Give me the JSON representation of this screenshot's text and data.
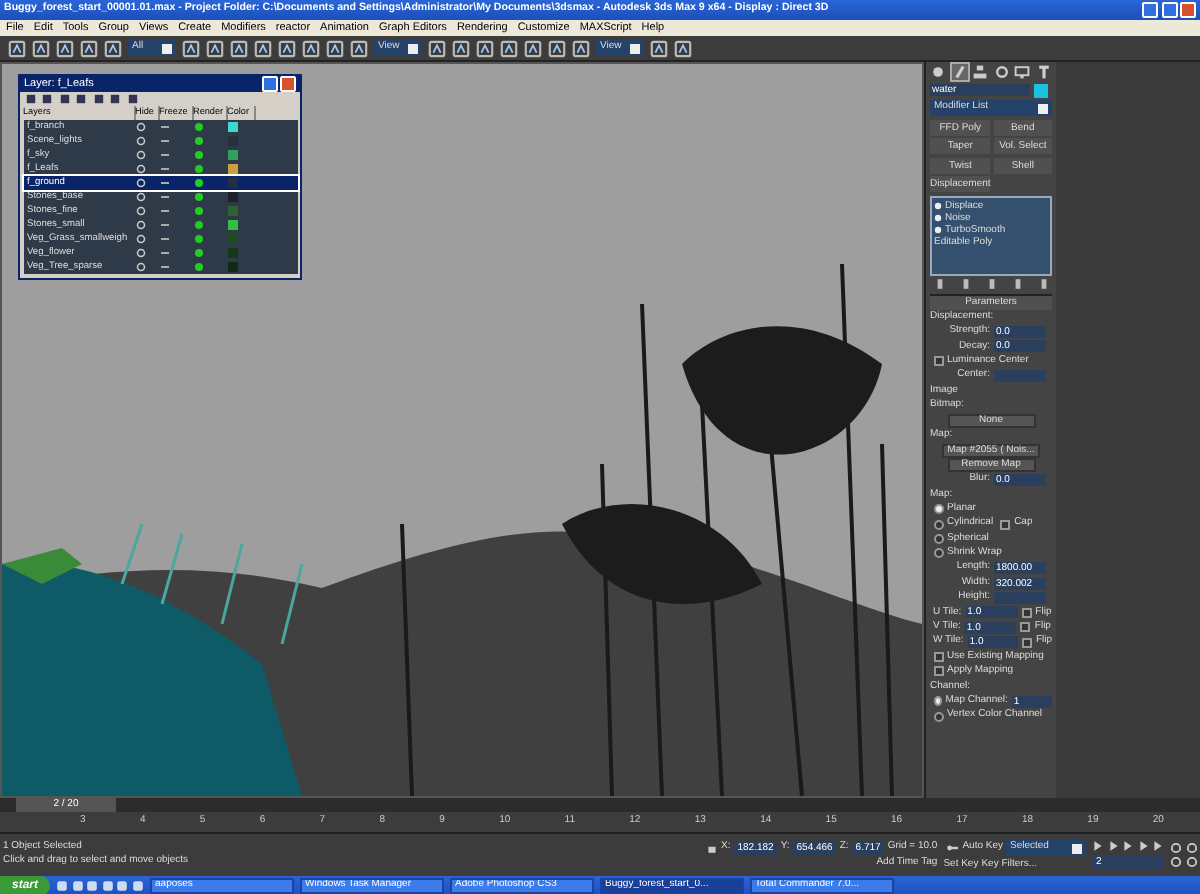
{
  "window": {
    "title": "Buggy_forest_start_00001.01.max - Project Folder: C:\\Documents and Settings\\Administrator\\My Documents\\3dsmax - Autodesk 3ds Max 9 x64 - Display : Direct 3D"
  },
  "menu": [
    "File",
    "Edit",
    "Tools",
    "Group",
    "Views",
    "Create",
    "Modifiers",
    "reactor",
    "Animation",
    "Graph Editors",
    "Rendering",
    "Customize",
    "MAXScript",
    "Help"
  ],
  "toolbar": {
    "dropdowns": [
      "All",
      "View",
      "View"
    ]
  },
  "layer_dialog": {
    "title": "Layer: f_Leafs",
    "columns": [
      "Layers",
      "Hide",
      "Freeze",
      "Render",
      "Color"
    ],
    "rows": [
      {
        "name": "f_branch",
        "selected": false,
        "color": "#3fd8d0"
      },
      {
        "name": "Scene_lights",
        "selected": false,
        "color": "#26303a"
      },
      {
        "name": "f_sky",
        "selected": false,
        "color": "#30a060"
      },
      {
        "name": "f_Leafs",
        "selected": false,
        "color": "#c8a040"
      },
      {
        "name": "f_ground",
        "selected": true,
        "color": "#203040"
      },
      {
        "name": "Stones_base",
        "selected": false,
        "color": "#1e2228"
      },
      {
        "name": "Stones_fine",
        "selected": false,
        "color": "#2e6030"
      },
      {
        "name": "Stones_small",
        "selected": false,
        "color": "#30c040"
      },
      {
        "name": "Veg_Grass_smallweigh",
        "selected": false,
        "color": "#204a24"
      },
      {
        "name": "Veg_flower",
        "selected": false,
        "color": "#143818"
      },
      {
        "name": "Veg_Tree_sparse",
        "selected": false,
        "color": "#102a14"
      }
    ]
  },
  "command_panel": {
    "tabs": [
      {
        "kind": "create",
        "selected": false
      },
      {
        "kind": "modify",
        "selected": true
      },
      {
        "kind": "hierarchy",
        "selected": false
      },
      {
        "kind": "motion",
        "selected": false
      },
      {
        "kind": "display",
        "selected": false
      },
      {
        "kind": "utilities",
        "selected": false
      }
    ],
    "object": {
      "name": "water",
      "color": "#19c3e0"
    },
    "modifier_list": "Modifier List",
    "modifier_buttons": [
      "FFD Poly",
      "Bend",
      "Taper",
      "Vol. Select",
      "Twist",
      "Shell",
      "Displacement"
    ],
    "stack": [
      {
        "label": "Displace",
        "kind": "modifier"
      },
      {
        "label": "Noise",
        "kind": "modifier"
      },
      {
        "label": "TurboSmooth",
        "kind": "modifier"
      },
      {
        "label": "Editable Poly",
        "kind": "base"
      }
    ],
    "parameters": [
      {
        "kind": "rollout",
        "label": "Parameters"
      },
      {
        "kind": "heading",
        "label": "Displacement:"
      },
      {
        "kind": "spinner",
        "label": "Strength:",
        "value": "0.0"
      },
      {
        "kind": "spinner",
        "label": "Decay:",
        "value": "0.0"
      },
      {
        "kind": "checkbox",
        "label": "Luminance Center",
        "checked": false
      },
      {
        "kind": "spinner",
        "label": "Center:"
      },
      {
        "kind": "heading",
        "label": "Image"
      },
      {
        "kind": "heading",
        "label": "Bitmap:"
      },
      {
        "kind": "button",
        "label": "None"
      },
      {
        "kind": "heading",
        "label": "Map:"
      },
      {
        "kind": "button",
        "label": "Map #2055 ( Nois..."
      },
      {
        "kind": "button",
        "label": "Remove Map"
      },
      {
        "kind": "spinner",
        "label": "Blur:",
        "value": "0.0"
      },
      {
        "kind": "heading",
        "label": "Map:"
      },
      {
        "kind": "radio",
        "label": "Planar",
        "selected": true
      },
      {
        "kind": "radio",
        "label": "Cylindrical",
        "selected": false,
        "extra": {
          "label": "Cap",
          "checked": false
        }
      },
      {
        "kind": "radio",
        "label": "Spherical",
        "selected": false
      },
      {
        "kind": "radio",
        "label": "Shrink Wrap",
        "selected": false
      },
      {
        "kind": "spinner",
        "label": "Length:",
        "value": "1800.00"
      },
      {
        "kind": "spinner",
        "label": "Width:",
        "value": "320.002"
      },
      {
        "kind": "spinner",
        "label": "Height:"
      },
      {
        "kind": "tile",
        "label": "U Tile:",
        "value": "1.0",
        "flip": "Flip",
        "checked": false
      },
      {
        "kind": "tile",
        "label": "V Tile:",
        "value": "1.0",
        "flip": "Flip",
        "checked": false
      },
      {
        "kind": "tile",
        "label": "W Tile:",
        "value": "1.0",
        "flip": "Flip",
        "checked": false
      },
      {
        "kind": "checkbox",
        "label": "Use Existing Mapping",
        "checked": false
      },
      {
        "kind": "checkbox",
        "label": "Apply Mapping",
        "checked": false
      },
      {
        "kind": "heading",
        "label": "Channel:"
      },
      {
        "kind": "radio",
        "label": "Map Channel:",
        "selected": true,
        "value": "1"
      },
      {
        "kind": "radio",
        "label": "Vertex Color Channel",
        "selected": false
      }
    ]
  },
  "timeline": {
    "slider": "2 / 20",
    "level": 0.02,
    "ticks": [
      "3",
      "4",
      "5",
      "6",
      "7",
      "8",
      "9",
      "10",
      "11",
      "12",
      "13",
      "14",
      "15",
      "16",
      "17",
      "18",
      "19",
      "20"
    ]
  },
  "status_bar": {
    "selection": "1 Object Selected",
    "prompt": "Click and drag to select and move objects",
    "coordinates": [
      {
        "label": "X:",
        "value": "182.182"
      },
      {
        "label": "Y:",
        "value": "654.466"
      },
      {
        "label": "Z:",
        "value": "6.717"
      }
    ],
    "grid": "Grid = 10.0",
    "time_tag": "Add Time Tag",
    "auto_key": "Auto Key",
    "key_mode": "Selected",
    "set_key": "Set Key",
    "key_filters": "Key Filters...",
    "frame": "2"
  },
  "taskbar": {
    "start": "start",
    "items": [
      {
        "label": "aaposes",
        "selected": false
      },
      {
        "label": "Windows Task Manager",
        "selected": false
      },
      {
        "label": "Adobe Photoshop CS3",
        "selected": false
      },
      {
        "label": "Buggy_forest_start_0...",
        "selected": true
      },
      {
        "label": "Total Commander 7.0...",
        "selected": false
      }
    ]
  }
}
